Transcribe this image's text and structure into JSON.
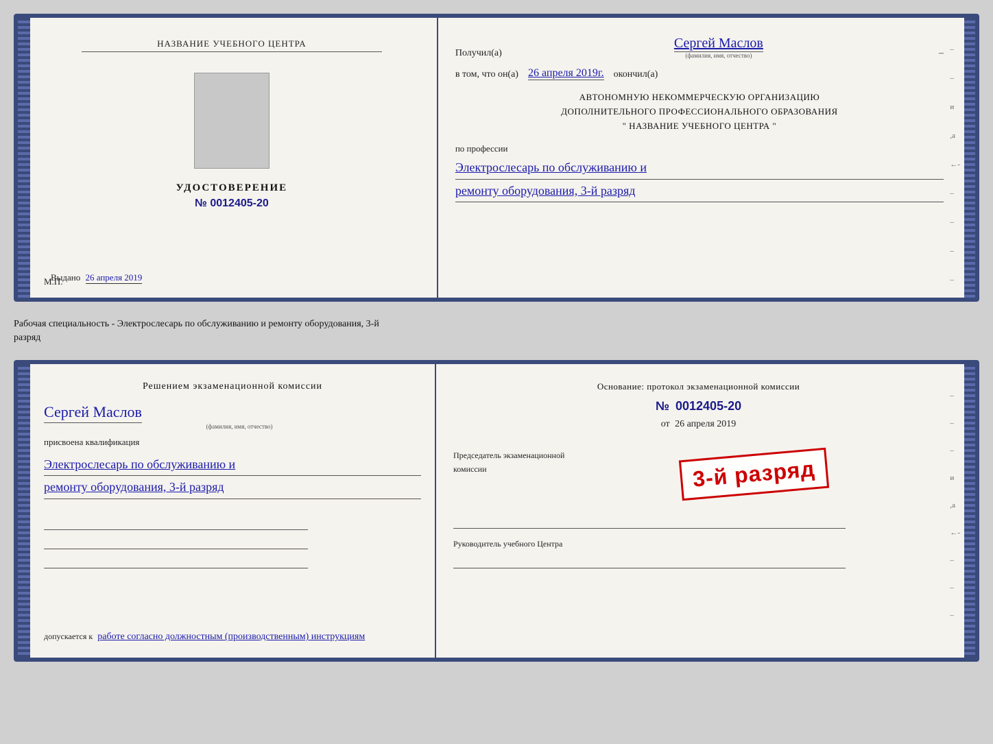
{
  "doc1": {
    "left": {
      "institution_name": "НАЗВАНИЕ УЧЕБНОГО ЦЕНТРА",
      "photo_alt": "Фото",
      "title": "УДОСТОВЕРЕНИЕ",
      "number_prefix": "№",
      "number": "0012405-20",
      "issued_label": "Выдано",
      "issued_date": "26 апреля 2019",
      "mp_label": "М.П."
    },
    "right": {
      "recipient_prefix": "Получил(а)",
      "recipient_name": "Сергей Маслов",
      "fio_subtitle": "(фамилия, имя, отчество)",
      "dash": "–",
      "date_prefix": "в том, что он(а)",
      "date_value": "26 апреля 2019г.",
      "date_suffix": "окончил(а)",
      "org_line1": "АВТОНОМНУЮ НЕКОММЕРЧЕСКУЮ ОРГАНИЗАЦИЮ",
      "org_line2": "ДОПОЛНИТЕЛЬНОГО ПРОФЕССИОНАЛЬНОГО ОБРАЗОВАНИЯ",
      "org_line3": "\" НАЗВАНИЕ УЧЕБНОГО ЦЕНТРА \"",
      "profession_label": "по профессии",
      "profession_line1": "Электрослесарь по обслуживанию и",
      "profession_line2": "ремонту оборудования, 3-й разряд"
    }
  },
  "between_text": {
    "line1": "Рабочая специальность - Электрослесарь по обслуживанию и ремонту оборудования, 3-й",
    "line2": "разряд"
  },
  "doc2": {
    "left": {
      "decision_title": "Решением экзаменационной комиссии",
      "name": "Сергей Маслов",
      "fio_subtitle": "(фамилия, имя, отчество)",
      "assigned_text": "присвоена квалификация",
      "profession_line1": "Электрослесарь по обслуживанию и",
      "profession_line2": "ремонту оборудования, 3-й разряд",
      "admission_prefix": "допускается к",
      "admission_text": "работе согласно должностным (производственным) инструкциям"
    },
    "right": {
      "basis_label": "Основание: протокол экзаменационной комиссии",
      "number_prefix": "№",
      "number": "0012405-20",
      "date_prefix": "от",
      "date": "26 апреля 2019",
      "stamp_small_line1": "Председатель экзаменационной",
      "stamp_small_line2": "комиссии",
      "stamp_large": "3-й разряд",
      "chairman_label": "Председатель экзаменационной комиссии",
      "director_label": "Руководитель учебного Центра"
    }
  }
}
